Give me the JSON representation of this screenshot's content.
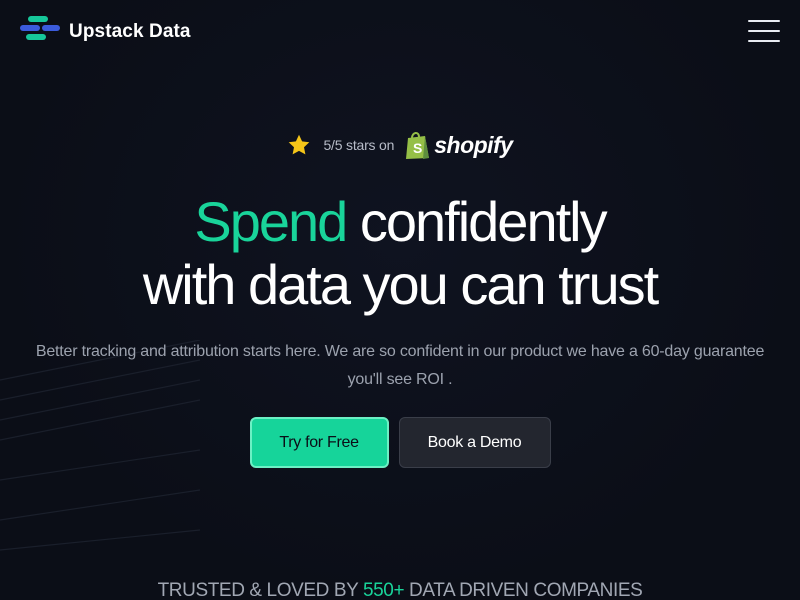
{
  "header": {
    "brand_name": "Upstack Data",
    "logo_icon": "upstack-logo-icon",
    "menu_icon": "hamburger-menu-icon"
  },
  "rating": {
    "star_icon": "star-icon",
    "text": "5/5 stars on",
    "platform_icon": "shopify-bag-icon",
    "platform_name": "shopify"
  },
  "hero": {
    "headline_accent": "Spend",
    "headline_rest_line1": "confidently",
    "headline_line2": "with data you can trust",
    "subtext_line1": "Better tracking and attribution starts here. We are so confident in our product we have a 60-day guarantee",
    "subtext_line2": "you'll see ROI ."
  },
  "cta": {
    "primary_label": "Try for Free",
    "secondary_label": "Book a Demo"
  },
  "trust": {
    "prefix": "TRUSTED & LOVED BY",
    "count": "550+",
    "suffix": "DATA DRIVEN COMPANIES"
  },
  "colors": {
    "background": "#0b0e17",
    "accent": "#19d49a",
    "logo_green": "#16c79a",
    "logo_blue": "#3b5bdb",
    "secondary_button": "#23262f",
    "star": "#f5c518",
    "shopify_green": "#95bf47"
  }
}
